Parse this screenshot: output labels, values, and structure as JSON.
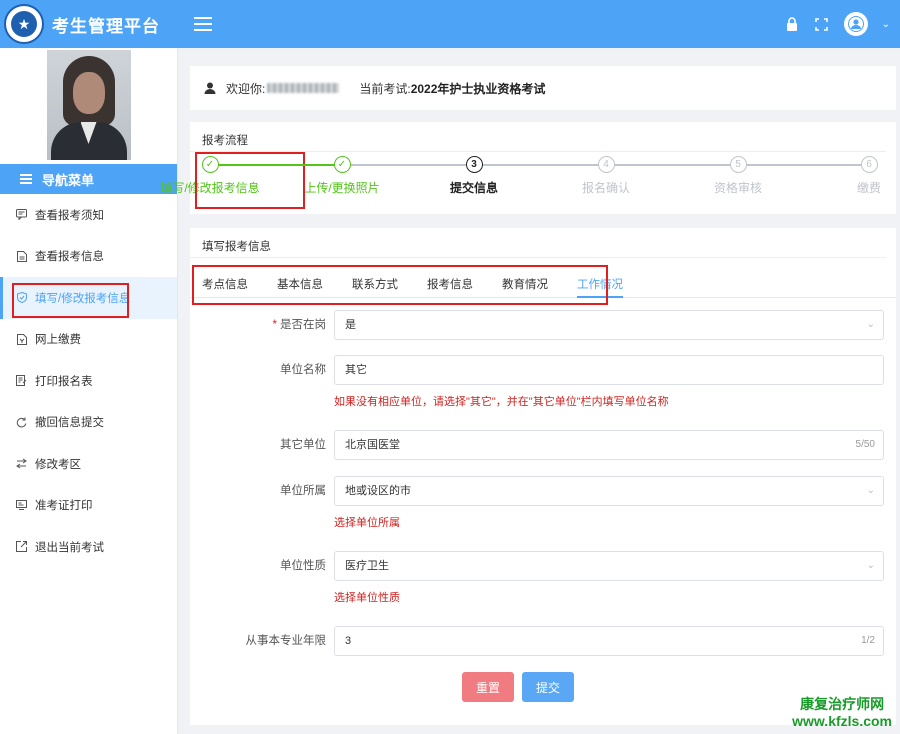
{
  "header": {
    "app_title": "考生管理平台",
    "icons": [
      "hamburger-icon",
      "lock-icon",
      "fullscreen-icon",
      "user-avatar-icon",
      "chevron-down-icon"
    ]
  },
  "sidebar": {
    "nav_title": "导航菜单",
    "items": [
      {
        "label": "查看报考须知",
        "icon": "message-icon"
      },
      {
        "label": "查看报考信息",
        "icon": "document-icon"
      },
      {
        "label": "填写/修改报考信息",
        "icon": "shield-check-icon",
        "active": true
      },
      {
        "label": "网上缴费",
        "icon": "payment-icon"
      },
      {
        "label": "打印报名表",
        "icon": "print-icon"
      },
      {
        "label": "撤回信息提交",
        "icon": "undo-icon"
      },
      {
        "label": "修改考区",
        "icon": "swap-icon"
      },
      {
        "label": "准考证打印",
        "icon": "card-icon"
      },
      {
        "label": "退出当前考试",
        "icon": "exit-icon"
      }
    ]
  },
  "welcome": {
    "greeting": "欢迎你:",
    "exam_label": "当前考试:",
    "exam_name": "2022年护士执业资格考试"
  },
  "flow": {
    "title": "报考流程",
    "steps": [
      {
        "num": "✓",
        "label": "填写/修改报考信息",
        "state": "done"
      },
      {
        "num": "✓",
        "label": "上传/更换照片",
        "state": "done"
      },
      {
        "num": "3",
        "label": "提交信息",
        "state": "current"
      },
      {
        "num": "4",
        "label": "报名确认",
        "state": "todo"
      },
      {
        "num": "5",
        "label": "资格审核",
        "state": "todo"
      },
      {
        "num": "6",
        "label": "缴费",
        "state": "todo"
      }
    ],
    "colors": {
      "done": "#52c41a",
      "current": "#222222",
      "todo": "#c0c4cc"
    }
  },
  "form": {
    "title": "填写报考信息",
    "tabs": [
      "考点信息",
      "基本信息",
      "联系方式",
      "报考信息",
      "教育情况",
      "工作情况"
    ],
    "active_tab": "工作情况",
    "fields": {
      "employed": {
        "label": "是否在岗",
        "required": "*",
        "value": "是"
      },
      "unit_name": {
        "label": "单位名称",
        "value": "其它",
        "hint": "如果没有相应单位，请选择\"其它\"，并在\"其它单位\"栏内填写单位名称"
      },
      "other_unit": {
        "label": "其它单位",
        "value": "北京国医堂",
        "counter": "5/50"
      },
      "unit_affiliation": {
        "label": "单位所属",
        "value": "地或设区的市",
        "hint": "选择单位所属"
      },
      "unit_nature": {
        "label": "单位性质",
        "value": "医疗卫生",
        "hint": "选择单位性质"
      },
      "years": {
        "label": "从事本专业年限",
        "value": "3",
        "counter": "1/2"
      }
    },
    "buttons": {
      "reset": "重置",
      "submit": "提交"
    }
  },
  "watermark": {
    "line1": "康复治疗师网",
    "line2": "www.kfzls.com"
  }
}
